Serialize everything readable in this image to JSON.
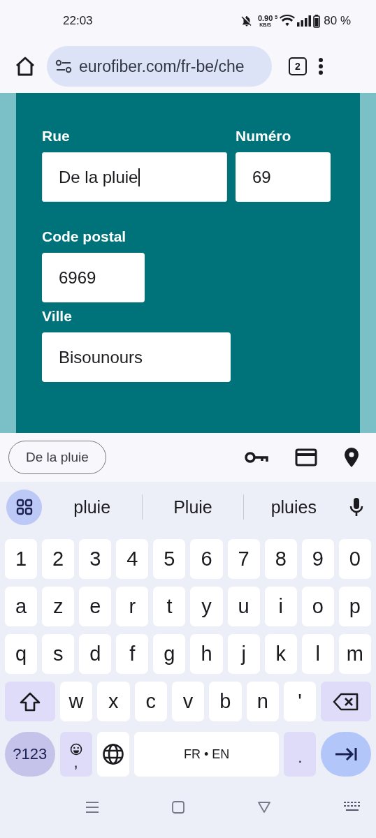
{
  "status_bar": {
    "time": "22:03",
    "network_speed": "0.90",
    "network_unit": "KB/S",
    "wifi_band": "5",
    "battery": "80 %"
  },
  "browser": {
    "url": "eurofiber.com/fr-be/che",
    "tab_count": "2"
  },
  "form": {
    "rows": [
      {
        "fields": [
          {
            "kind": "street",
            "label": "Rue",
            "value": "De la pluie",
            "focused": true
          },
          {
            "kind": "number",
            "label": "Numéro",
            "value": "69",
            "focused": false
          }
        ]
      },
      {
        "fields": [
          {
            "kind": "postal",
            "label": "Code postal",
            "value": "6969",
            "focused": false
          }
        ]
      },
      {
        "fields": [
          {
            "kind": "city",
            "label": "Ville",
            "value": "Bisounours",
            "focused": false
          }
        ]
      }
    ]
  },
  "autofill": {
    "suggestion": "De la pluie"
  },
  "suggestions": [
    "pluie",
    "Pluie",
    "pluies"
  ],
  "keyboard": {
    "rows": [
      {
        "keys": [
          {
            "kind": "char",
            "label": "1"
          },
          {
            "kind": "char",
            "label": "2"
          },
          {
            "kind": "char",
            "label": "3"
          },
          {
            "kind": "char",
            "label": "4"
          },
          {
            "kind": "char",
            "label": "5"
          },
          {
            "kind": "char",
            "label": "6"
          },
          {
            "kind": "char",
            "label": "7"
          },
          {
            "kind": "char",
            "label": "8"
          },
          {
            "kind": "char",
            "label": "9"
          },
          {
            "kind": "char",
            "label": "0"
          }
        ]
      },
      {
        "keys": [
          {
            "kind": "char",
            "label": "a"
          },
          {
            "kind": "char",
            "label": "z"
          },
          {
            "kind": "char",
            "label": "e"
          },
          {
            "kind": "char",
            "label": "r"
          },
          {
            "kind": "char",
            "label": "t"
          },
          {
            "kind": "char",
            "label": "y"
          },
          {
            "kind": "char",
            "label": "u"
          },
          {
            "kind": "char",
            "label": "i"
          },
          {
            "kind": "char",
            "label": "o"
          },
          {
            "kind": "char",
            "label": "p"
          }
        ]
      },
      {
        "keys": [
          {
            "kind": "char",
            "label": "q"
          },
          {
            "kind": "char",
            "label": "s"
          },
          {
            "kind": "char",
            "label": "d"
          },
          {
            "kind": "char",
            "label": "f"
          },
          {
            "kind": "char",
            "label": "g"
          },
          {
            "kind": "char",
            "label": "h"
          },
          {
            "kind": "char",
            "label": "j"
          },
          {
            "kind": "char",
            "label": "k"
          },
          {
            "kind": "char",
            "label": "l"
          },
          {
            "kind": "char",
            "label": "m"
          }
        ]
      },
      {
        "keys": [
          {
            "kind": "shift"
          },
          {
            "kind": "char",
            "label": "w"
          },
          {
            "kind": "char",
            "label": "x"
          },
          {
            "kind": "char",
            "label": "c"
          },
          {
            "kind": "char",
            "label": "v"
          },
          {
            "kind": "char",
            "label": "b"
          },
          {
            "kind": "char",
            "label": "n"
          },
          {
            "kind": "char",
            "label": "'"
          },
          {
            "kind": "backspace"
          }
        ]
      },
      {
        "keys": [
          {
            "kind": "symbols",
            "label": "?123"
          },
          {
            "kind": "emoji",
            "label": ","
          },
          {
            "kind": "globe"
          },
          {
            "kind": "space",
            "label": "FR • EN"
          },
          {
            "kind": "period",
            "label": "."
          },
          {
            "kind": "enter"
          }
        ]
      }
    ]
  }
}
